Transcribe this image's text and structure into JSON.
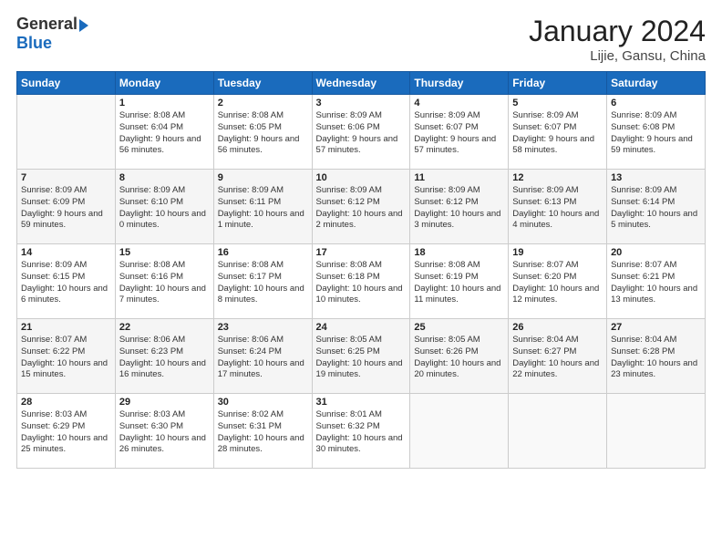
{
  "logo": {
    "general": "General",
    "blue": "Blue"
  },
  "header": {
    "month": "January 2024",
    "location": "Lijie, Gansu, China"
  },
  "days_of_week": [
    "Sunday",
    "Monday",
    "Tuesday",
    "Wednesday",
    "Thursday",
    "Friday",
    "Saturday"
  ],
  "weeks": [
    [
      {
        "day": "",
        "sunrise": "",
        "sunset": "",
        "daylight": ""
      },
      {
        "day": "1",
        "sunrise": "Sunrise: 8:08 AM",
        "sunset": "Sunset: 6:04 PM",
        "daylight": "Daylight: 9 hours and 56 minutes."
      },
      {
        "day": "2",
        "sunrise": "Sunrise: 8:08 AM",
        "sunset": "Sunset: 6:05 PM",
        "daylight": "Daylight: 9 hours and 56 minutes."
      },
      {
        "day": "3",
        "sunrise": "Sunrise: 8:09 AM",
        "sunset": "Sunset: 6:06 PM",
        "daylight": "Daylight: 9 hours and 57 minutes."
      },
      {
        "day": "4",
        "sunrise": "Sunrise: 8:09 AM",
        "sunset": "Sunset: 6:07 PM",
        "daylight": "Daylight: 9 hours and 57 minutes."
      },
      {
        "day": "5",
        "sunrise": "Sunrise: 8:09 AM",
        "sunset": "Sunset: 6:07 PM",
        "daylight": "Daylight: 9 hours and 58 minutes."
      },
      {
        "day": "6",
        "sunrise": "Sunrise: 8:09 AM",
        "sunset": "Sunset: 6:08 PM",
        "daylight": "Daylight: 9 hours and 59 minutes."
      }
    ],
    [
      {
        "day": "7",
        "sunrise": "Sunrise: 8:09 AM",
        "sunset": "Sunset: 6:09 PM",
        "daylight": "Daylight: 9 hours and 59 minutes."
      },
      {
        "day": "8",
        "sunrise": "Sunrise: 8:09 AM",
        "sunset": "Sunset: 6:10 PM",
        "daylight": "Daylight: 10 hours and 0 minutes."
      },
      {
        "day": "9",
        "sunrise": "Sunrise: 8:09 AM",
        "sunset": "Sunset: 6:11 PM",
        "daylight": "Daylight: 10 hours and 1 minute."
      },
      {
        "day": "10",
        "sunrise": "Sunrise: 8:09 AM",
        "sunset": "Sunset: 6:12 PM",
        "daylight": "Daylight: 10 hours and 2 minutes."
      },
      {
        "day": "11",
        "sunrise": "Sunrise: 8:09 AM",
        "sunset": "Sunset: 6:12 PM",
        "daylight": "Daylight: 10 hours and 3 minutes."
      },
      {
        "day": "12",
        "sunrise": "Sunrise: 8:09 AM",
        "sunset": "Sunset: 6:13 PM",
        "daylight": "Daylight: 10 hours and 4 minutes."
      },
      {
        "day": "13",
        "sunrise": "Sunrise: 8:09 AM",
        "sunset": "Sunset: 6:14 PM",
        "daylight": "Daylight: 10 hours and 5 minutes."
      }
    ],
    [
      {
        "day": "14",
        "sunrise": "Sunrise: 8:09 AM",
        "sunset": "Sunset: 6:15 PM",
        "daylight": "Daylight: 10 hours and 6 minutes."
      },
      {
        "day": "15",
        "sunrise": "Sunrise: 8:08 AM",
        "sunset": "Sunset: 6:16 PM",
        "daylight": "Daylight: 10 hours and 7 minutes."
      },
      {
        "day": "16",
        "sunrise": "Sunrise: 8:08 AM",
        "sunset": "Sunset: 6:17 PM",
        "daylight": "Daylight: 10 hours and 8 minutes."
      },
      {
        "day": "17",
        "sunrise": "Sunrise: 8:08 AM",
        "sunset": "Sunset: 6:18 PM",
        "daylight": "Daylight: 10 hours and 10 minutes."
      },
      {
        "day": "18",
        "sunrise": "Sunrise: 8:08 AM",
        "sunset": "Sunset: 6:19 PM",
        "daylight": "Daylight: 10 hours and 11 minutes."
      },
      {
        "day": "19",
        "sunrise": "Sunrise: 8:07 AM",
        "sunset": "Sunset: 6:20 PM",
        "daylight": "Daylight: 10 hours and 12 minutes."
      },
      {
        "day": "20",
        "sunrise": "Sunrise: 8:07 AM",
        "sunset": "Sunset: 6:21 PM",
        "daylight": "Daylight: 10 hours and 13 minutes."
      }
    ],
    [
      {
        "day": "21",
        "sunrise": "Sunrise: 8:07 AM",
        "sunset": "Sunset: 6:22 PM",
        "daylight": "Daylight: 10 hours and 15 minutes."
      },
      {
        "day": "22",
        "sunrise": "Sunrise: 8:06 AM",
        "sunset": "Sunset: 6:23 PM",
        "daylight": "Daylight: 10 hours and 16 minutes."
      },
      {
        "day": "23",
        "sunrise": "Sunrise: 8:06 AM",
        "sunset": "Sunset: 6:24 PM",
        "daylight": "Daylight: 10 hours and 17 minutes."
      },
      {
        "day": "24",
        "sunrise": "Sunrise: 8:05 AM",
        "sunset": "Sunset: 6:25 PM",
        "daylight": "Daylight: 10 hours and 19 minutes."
      },
      {
        "day": "25",
        "sunrise": "Sunrise: 8:05 AM",
        "sunset": "Sunset: 6:26 PM",
        "daylight": "Daylight: 10 hours and 20 minutes."
      },
      {
        "day": "26",
        "sunrise": "Sunrise: 8:04 AM",
        "sunset": "Sunset: 6:27 PM",
        "daylight": "Daylight: 10 hours and 22 minutes."
      },
      {
        "day": "27",
        "sunrise": "Sunrise: 8:04 AM",
        "sunset": "Sunset: 6:28 PM",
        "daylight": "Daylight: 10 hours and 23 minutes."
      }
    ],
    [
      {
        "day": "28",
        "sunrise": "Sunrise: 8:03 AM",
        "sunset": "Sunset: 6:29 PM",
        "daylight": "Daylight: 10 hours and 25 minutes."
      },
      {
        "day": "29",
        "sunrise": "Sunrise: 8:03 AM",
        "sunset": "Sunset: 6:30 PM",
        "daylight": "Daylight: 10 hours and 26 minutes."
      },
      {
        "day": "30",
        "sunrise": "Sunrise: 8:02 AM",
        "sunset": "Sunset: 6:31 PM",
        "daylight": "Daylight: 10 hours and 28 minutes."
      },
      {
        "day": "31",
        "sunrise": "Sunrise: 8:01 AM",
        "sunset": "Sunset: 6:32 PM",
        "daylight": "Daylight: 10 hours and 30 minutes."
      },
      {
        "day": "",
        "sunrise": "",
        "sunset": "",
        "daylight": ""
      },
      {
        "day": "",
        "sunrise": "",
        "sunset": "",
        "daylight": ""
      },
      {
        "day": "",
        "sunrise": "",
        "sunset": "",
        "daylight": ""
      }
    ]
  ]
}
